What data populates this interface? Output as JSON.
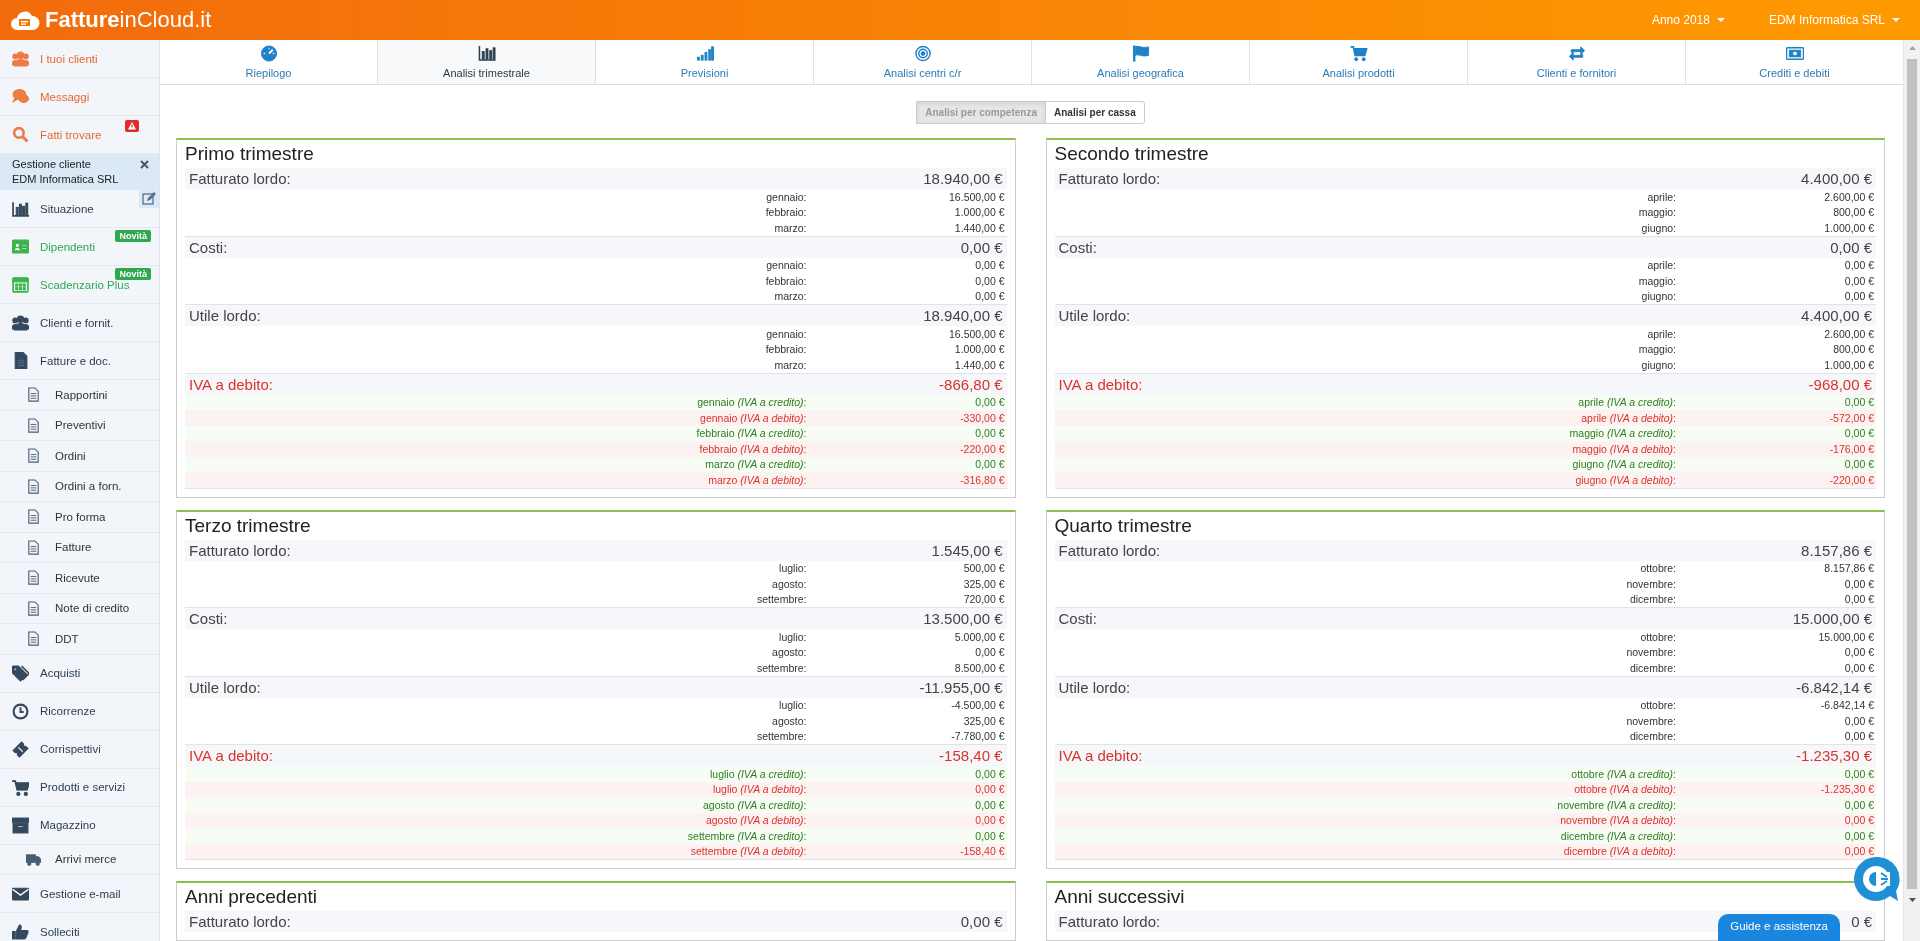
{
  "header": {
    "logo": "**Fatture**inCloud.it",
    "menus": [
      "Anno 2018",
      "EDM Informatica SRL"
    ]
  },
  "sidebar": {
    "items_top": [
      {
        "label": "I tuoi clienti",
        "kind": "accent"
      },
      {
        "label": "Messaggi",
        "kind": "accent"
      },
      {
        "label": "Fatti trovare",
        "kind": "accent",
        "alert": true
      }
    ],
    "client": {
      "caption": "Gestione cliente",
      "name": "EDM Informatica SRL"
    },
    "items": [
      {
        "label": "Situazione",
        "kind": "normal"
      },
      {
        "label": "Dipendenti",
        "kind": "new",
        "badge": "Novità"
      },
      {
        "label": "Scadenzario Plus",
        "kind": "new",
        "badge": "Novità"
      },
      {
        "label": "Clienti e fornit.",
        "kind": "normal"
      },
      {
        "label": "Fatture e doc.",
        "kind": "normal",
        "children": [
          {
            "label": "Rapportini"
          },
          {
            "label": "Preventivi"
          },
          {
            "label": "Ordini"
          },
          {
            "label": "Ordini a forn."
          },
          {
            "label": "Pro forma"
          },
          {
            "label": "Fatture"
          },
          {
            "label": "Ricevute"
          },
          {
            "label": "Note di credito"
          },
          {
            "label": "DDT"
          }
        ]
      },
      {
        "label": "Acquisti",
        "kind": "normal"
      },
      {
        "label": "Ricorrenze",
        "kind": "normal"
      },
      {
        "label": "Corrispettivi",
        "kind": "normal"
      },
      {
        "label": "Prodotti e servizi",
        "kind": "normal"
      },
      {
        "label": "Magazzino",
        "kind": "normal",
        "children": [
          {
            "label": "Arrivi merce"
          }
        ]
      },
      {
        "label": "Gestione e-mail",
        "kind": "normal"
      },
      {
        "label": "Solleciti",
        "kind": "normal"
      }
    ]
  },
  "nav": {
    "tabs": [
      {
        "label": "Riepilogo",
        "selected": false
      },
      {
        "label": "Analisi trimestrale",
        "selected": true
      },
      {
        "label": "Previsioni",
        "selected": false
      },
      {
        "label": "Analisi centri c/r",
        "selected": false
      },
      {
        "label": "Analisi geografica",
        "selected": false
      },
      {
        "label": "Analisi prodotti",
        "selected": false
      },
      {
        "label": "Clienti e fornitori",
        "selected": false
      },
      {
        "label": "Crediti e debiti",
        "selected": false
      }
    ]
  },
  "toggle": [
    {
      "label": "Analisi per competenza",
      "selected": true
    },
    {
      "label": "Analisi per cassa",
      "selected": false
    }
  ],
  "cards": [
    {
      "title": "Primo trimestre",
      "sections": [
        {
          "kind": "amount",
          "label": "Fatturato lordo:",
          "total": "18.940,00 €",
          "months": [
            {
              "label": "gennaio:",
              "value": "16.500,00 €"
            },
            {
              "label": "febbraio:",
              "value": "1.000,00 €"
            },
            {
              "label": "marzo:",
              "value": "1.440,00 €"
            }
          ]
        },
        {
          "kind": "amount",
          "label": "Costi:",
          "total": "0,00 €",
          "months": [
            {
              "label": "gennaio:",
              "value": "0,00 €"
            },
            {
              "label": "febbraio:",
              "value": "0,00 €"
            },
            {
              "label": "marzo:",
              "value": "0,00 €"
            }
          ]
        },
        {
          "kind": "amount",
          "label": "Utile lordo:",
          "total": "18.940,00 €",
          "months": [
            {
              "label": "gennaio:",
              "value": "16.500,00 €"
            },
            {
              "label": "febbraio:",
              "value": "1.000,00 €"
            },
            {
              "label": "marzo:",
              "value": "1.440,00 €"
            }
          ]
        },
        {
          "kind": "iva",
          "label": "IVA a debito:",
          "total": "-866,80 €",
          "months": [
            {
              "kind": "credit",
              "label": "gennaio *(IVA a credito)*:",
              "value": "0,00 €"
            },
            {
              "kind": "debit",
              "label": "gennaio *(IVA a debito)*:",
              "value": "-330,00 €"
            },
            {
              "kind": "credit",
              "label": "febbraio *(IVA a credito)*:",
              "value": "0,00 €"
            },
            {
              "kind": "debit",
              "label": "febbraio *(IVA a debito)*:",
              "value": "-220,00 €"
            },
            {
              "kind": "credit",
              "label": "marzo *(IVA a credito)*:",
              "value": "0,00 €"
            },
            {
              "kind": "debit",
              "label": "marzo *(IVA a debito)*:",
              "value": "-316,80 €"
            }
          ]
        }
      ]
    },
    {
      "title": "Secondo trimestre",
      "sections": [
        {
          "kind": "amount",
          "label": "Fatturato lordo:",
          "total": "4.400,00 €",
          "months": [
            {
              "label": "aprile:",
              "value": "2.600,00 €"
            },
            {
              "label": "maggio:",
              "value": "800,00 €"
            },
            {
              "label": "giugno:",
              "value": "1.000,00 €"
            }
          ]
        },
        {
          "kind": "amount",
          "label": "Costi:",
          "total": "0,00 €",
          "months": [
            {
              "label": "aprile:",
              "value": "0,00 €"
            },
            {
              "label": "maggio:",
              "value": "0,00 €"
            },
            {
              "label": "giugno:",
              "value": "0,00 €"
            }
          ]
        },
        {
          "kind": "amount",
          "label": "Utile lordo:",
          "total": "4.400,00 €",
          "months": [
            {
              "label": "aprile:",
              "value": "2.600,00 €"
            },
            {
              "label": "maggio:",
              "value": "800,00 €"
            },
            {
              "label": "giugno:",
              "value": "1.000,00 €"
            }
          ]
        },
        {
          "kind": "iva",
          "label": "IVA a debito:",
          "total": "-968,00 €",
          "months": [
            {
              "kind": "credit",
              "label": "aprile *(IVA a credito)*:",
              "value": "0,00 €"
            },
            {
              "kind": "debit",
              "label": "aprile *(IVA a debito)*:",
              "value": "-572,00 €"
            },
            {
              "kind": "credit",
              "label": "maggio *(IVA a credito)*:",
              "value": "0,00 €"
            },
            {
              "kind": "debit",
              "label": "maggio *(IVA a debito)*:",
              "value": "-176,00 €"
            },
            {
              "kind": "credit",
              "label": "giugno *(IVA a credito)*:",
              "value": "0,00 €"
            },
            {
              "kind": "debit",
              "label": "giugno *(IVA a debito)*:",
              "value": "-220,00 €"
            }
          ]
        }
      ]
    },
    {
      "title": "Terzo trimestre",
      "sections": [
        {
          "kind": "amount",
          "label": "Fatturato lordo:",
          "total": "1.545,00 €",
          "months": [
            {
              "label": "luglio:",
              "value": "500,00 €"
            },
            {
              "label": "agosto:",
              "value": "325,00 €"
            },
            {
              "label": "settembre:",
              "value": "720,00 €"
            }
          ]
        },
        {
          "kind": "amount",
          "label": "Costi:",
          "total": "13.500,00 €",
          "months": [
            {
              "label": "luglio:",
              "value": "5.000,00 €"
            },
            {
              "label": "agosto:",
              "value": "0,00 €"
            },
            {
              "label": "settembre:",
              "value": "8.500,00 €"
            }
          ]
        },
        {
          "kind": "amount",
          "label": "Utile lordo:",
          "total": "-11.955,00 €",
          "months": [
            {
              "label": "luglio:",
              "value": "-4.500,00 €"
            },
            {
              "label": "agosto:",
              "value": "325,00 €"
            },
            {
              "label": "settembre:",
              "value": "-7.780,00 €"
            }
          ]
        },
        {
          "kind": "iva",
          "label": "IVA a debito:",
          "total": "-158,40 €",
          "months": [
            {
              "kind": "credit",
              "label": "luglio *(IVA a credito)*:",
              "value": "0,00 €"
            },
            {
              "kind": "debit",
              "label": "luglio *(IVA a debito)*:",
              "value": "0,00 €"
            },
            {
              "kind": "credit",
              "label": "agosto *(IVA a credito)*:",
              "value": "0,00 €"
            },
            {
              "kind": "debit",
              "label": "agosto *(IVA a debito)*:",
              "value": "0,00 €"
            },
            {
              "kind": "credit",
              "label": "settembre *(IVA a credito)*:",
              "value": "0,00 €"
            },
            {
              "kind": "debit",
              "label": "settembre *(IVA a debito)*:",
              "value": "-158,40 €"
            }
          ]
        }
      ]
    },
    {
      "title": "Quarto trimestre",
      "sections": [
        {
          "kind": "amount",
          "label": "Fatturato lordo:",
          "total": "8.157,86 €",
          "months": [
            {
              "label": "ottobre:",
              "value": "8.157,86 €"
            },
            {
              "label": "novembre:",
              "value": "0,00 €"
            },
            {
              "label": "dicembre:",
              "value": "0,00 €"
            }
          ]
        },
        {
          "kind": "amount",
          "label": "Costi:",
          "total": "15.000,00 €",
          "months": [
            {
              "label": "ottobre:",
              "value": "15.000,00 €"
            },
            {
              "label": "novembre:",
              "value": "0,00 €"
            },
            {
              "label": "dicembre:",
              "value": "0,00 €"
            }
          ]
        },
        {
          "kind": "amount",
          "label": "Utile lordo:",
          "total": "-6.842,14 €",
          "months": [
            {
              "label": "ottobre:",
              "value": "-6.842,14 €"
            },
            {
              "label": "novembre:",
              "value": "0,00 €"
            },
            {
              "label": "dicembre:",
              "value": "0,00 €"
            }
          ]
        },
        {
          "kind": "iva",
          "label": "IVA a debito:",
          "total": "-1.235,30 €",
          "months": [
            {
              "kind": "credit",
              "label": "ottobre *(IVA a credito)*:",
              "value": "0,00 €"
            },
            {
              "kind": "debit",
              "label": "ottobre *(IVA a debito)*:",
              "value": "-1.235,30 €"
            },
            {
              "kind": "credit",
              "label": "novembre *(IVA a credito)*:",
              "value": "0,00 €"
            },
            {
              "kind": "debit",
              "label": "novembre *(IVA a debito)*:",
              "value": "0,00 €"
            },
            {
              "kind": "credit",
              "label": "dicembre *(IVA a credito)*:",
              "value": "0,00 €"
            },
            {
              "kind": "debit",
              "label": "dicembre *(IVA a debito)*:",
              "value": "0,00 €"
            }
          ]
        }
      ]
    },
    {
      "title": "Anni precedenti",
      "sections": [
        {
          "kind": "amount",
          "label": "Fatturato lordo:",
          "total": "0,00 €"
        }
      ]
    },
    {
      "title": "Anni successivi",
      "sections": [
        {
          "kind": "amount",
          "label": "Fatturato lordo:",
          "total": "0 €"
        }
      ]
    }
  ],
  "help": {
    "label": "Guide e assistenza"
  }
}
